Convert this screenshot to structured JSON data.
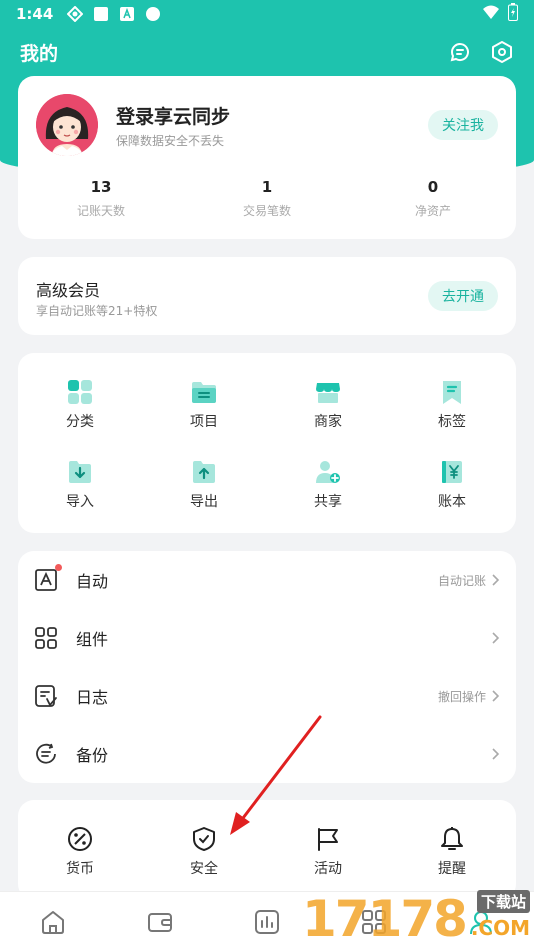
{
  "status_bar": {
    "time": "1:44"
  },
  "header": {
    "title": "我的"
  },
  "profile": {
    "name": "登录享云同步",
    "subtitle": "保障数据安全不丢失",
    "follow_label": "关注我",
    "stats": [
      {
        "value": "13",
        "label": "记账天数"
      },
      {
        "value": "1",
        "label": "交易笔数"
      },
      {
        "value": "0",
        "label": "净资产"
      }
    ]
  },
  "vip": {
    "title": "高级会员",
    "subtitle": "享自动记账等21+特权",
    "button": "去开通"
  },
  "grid": {
    "items": [
      {
        "label": "分类",
        "icon": "category-icon"
      },
      {
        "label": "项目",
        "icon": "project-folder-icon"
      },
      {
        "label": "商家",
        "icon": "store-icon"
      },
      {
        "label": "标签",
        "icon": "bookmark-tag-icon"
      },
      {
        "label": "导入",
        "icon": "import-icon"
      },
      {
        "label": "导出",
        "icon": "export-icon"
      },
      {
        "label": "共享",
        "icon": "share-user-icon"
      },
      {
        "label": "账本",
        "icon": "ledger-yen-icon"
      }
    ]
  },
  "list": {
    "rows": [
      {
        "label": "自动",
        "right": "自动记账",
        "icon": "auto-a-icon",
        "badge": true
      },
      {
        "label": "组件",
        "right": "",
        "icon": "widget-grid-icon",
        "badge": false
      },
      {
        "label": "日志",
        "right": "撤回操作",
        "icon": "log-icon",
        "badge": false
      },
      {
        "label": "备份",
        "right": "",
        "icon": "backup-icon",
        "badge": false
      }
    ]
  },
  "tools": {
    "items": [
      {
        "label": "货币",
        "icon": "percent-currency-icon"
      },
      {
        "label": "安全",
        "icon": "shield-check-icon"
      },
      {
        "label": "活动",
        "icon": "flag-icon"
      },
      {
        "label": "提醒",
        "icon": "bell-icon"
      }
    ]
  },
  "watermark": {
    "digits": "17178",
    "site": "下载站",
    "domain": ".COM"
  },
  "colors": {
    "accent": "#1ec3ae",
    "accent_light": "#e3f7f3",
    "badge": "#f25a5a",
    "arrow": "#e02020"
  }
}
